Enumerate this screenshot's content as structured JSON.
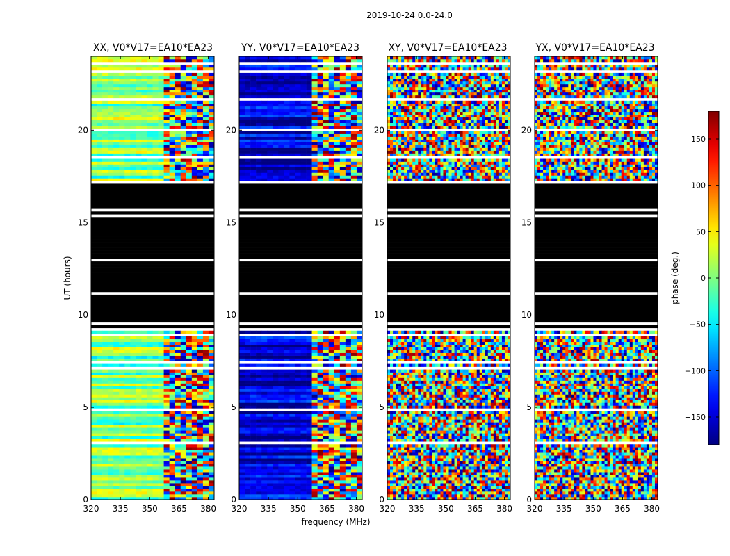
{
  "chart_data": {
    "type": "heatmap",
    "suptitle": "2019-10-24 0.0-24.0",
    "xlabel": "frequency (MHz)",
    "ylabel": "UT (hours)",
    "xlim": [
      320,
      383
    ],
    "ylim": [
      0,
      24
    ],
    "xticks": [
      "320",
      "335",
      "350",
      "365",
      "380"
    ],
    "yticks": [
      "0",
      "5",
      "10",
      "15",
      "20"
    ],
    "colorbar": {
      "label": "phase (deg.)",
      "range": [
        -180,
        180
      ],
      "ticks": [
        "150",
        "100",
        "50",
        "0",
        "−50",
        "−100",
        "−150"
      ],
      "colormap": "jet"
    },
    "panels": [
      {
        "title": "XX, V0*V17=EA10*EA23",
        "dominant_phase_deg": 0,
        "description_mode": "smooth"
      },
      {
        "title": "YY, V0*V17=EA10*EA23",
        "dominant_phase_deg": -150,
        "description_mode": "smooth"
      },
      {
        "title": "XY, V0*V17=EA10*EA23",
        "dominant_phase_deg": null,
        "description_mode": "noise"
      },
      {
        "title": "YX, V0*V17=EA10*EA23",
        "dominant_phase_deg": null,
        "description_mode": "noise"
      }
    ],
    "flagged_ut_range": [
      9.1,
      17.0
    ],
    "flag_color": "#000000"
  }
}
